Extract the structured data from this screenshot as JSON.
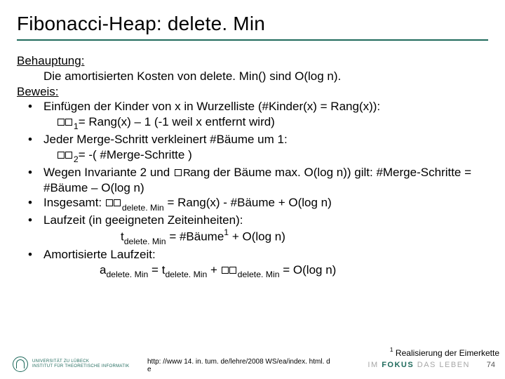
{
  "title": "Fibonacci-Heap: delete. Min",
  "claim_label": "Behauptung:",
  "claim_text": "Die amortisierten Kosten von delete. Min() sind O(log n).",
  "proof_label": "Beweis:",
  "b1_a": "Einfügen der Kinder von x in Wurzelliste (#Kinder(x) = Rang(x)):",
  "b1_eq_sub": "1",
  "b1_eq_rhs": "= Rang(x) – 1 (-1 weil x entfernt wird)",
  "b2_a": "Jeder Merge-Schritt verkleinert #Bäume um 1:",
  "b2_eq_sub": "2",
  "b2_eq_rhs": "= -( #Merge-Schritte )",
  "b3_a": "Wegen Invariante 2 und ",
  "b3_b": "ang der Bäume max. O(log n)) gilt: #Merge-Schritte = #Bäume – O(log n)",
  "b4_a": "Insgesamt: ",
  "b4_sub": "delete. Min",
  "b4_rhs": " = Rang(x) - #Bäume + O(log n)",
  "b5_a": "Laufzeit (in geeigneten Zeiteinheiten):",
  "b5_eq_lhs": "t",
  "b5_eq_sub": "delete. Min",
  "b5_eq_rhs_a": " = #Bäume",
  "b5_eq_sup": "1",
  "b5_eq_rhs_b": " + O(log n)",
  "b6_a": "Amortisierte Laufzeit:",
  "b6_a1": "a",
  "b6_sub1": "delete. Min",
  "b6_mid1": " = t",
  "b6_sub2": "delete. Min",
  "b6_mid2": " + ",
  "b6_sub3": "delete. Min",
  "b6_rhs": " = O(log n)",
  "footnote_sup": "1",
  "footnote_txt": " Realisierung der Eimerkette",
  "src_line1": "http: //www 14. in. tum. de/lehre/2008 WS/ea/index. html. d",
  "src_line2": "e",
  "logo_line1": "UNIVERSITÄT ZU LÜBECK",
  "logo_line2": "INSTITUT FÜR THEORETISCHE INFORMATIK",
  "focus_pre": "IM ",
  "focus_bold": "FOKUS",
  "focus_post": " DAS LEBEN",
  "pagenum": "74"
}
